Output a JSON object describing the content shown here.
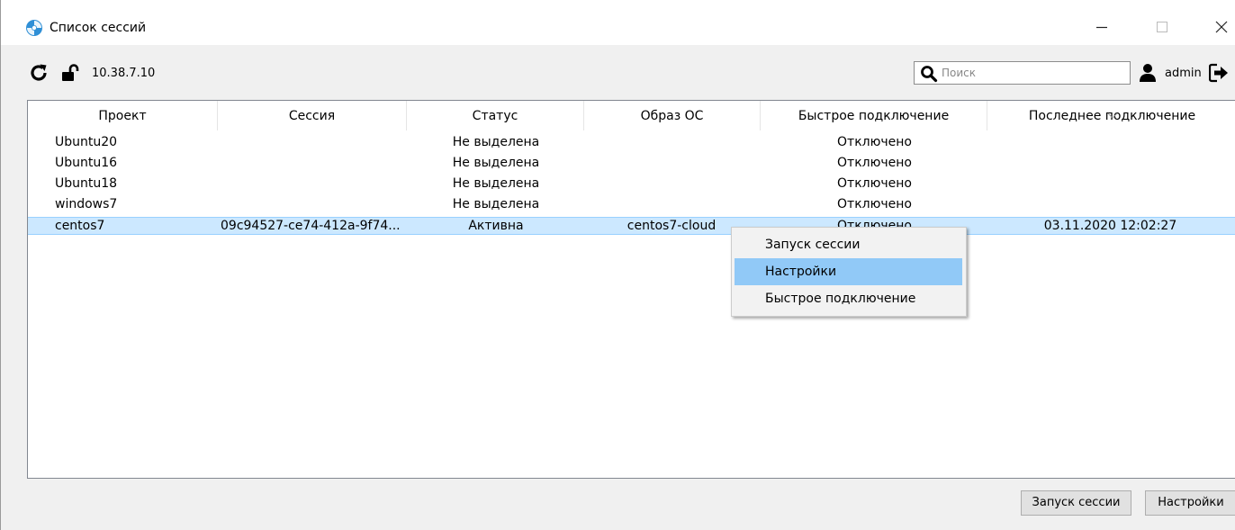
{
  "window": {
    "title": "Список сессий",
    "minimize_glyph": "—",
    "maximize_glyph": "☐",
    "close_glyph": "✕"
  },
  "toolbar": {
    "host": "10.38.7.10",
    "search_placeholder": "Поиск",
    "search_value": "",
    "user": "admin",
    "icons": [
      "refresh-icon",
      "unlock-icon",
      "search-icon",
      "user-icon",
      "logout-icon"
    ]
  },
  "table": {
    "columns": [
      "Проект",
      "Сессия",
      "Статус",
      "Образ ОС",
      "Быстрое подключение",
      "Последнее подключение"
    ],
    "sorted_column": "Последнее подключение",
    "rows": [
      {
        "project": "Ubuntu20",
        "session": "",
        "status": "Не выделена",
        "image": "",
        "quick": "Отключено",
        "last": ""
      },
      {
        "project": "Ubuntu16",
        "session": "",
        "status": "Не выделена",
        "image": "",
        "quick": "Отключено",
        "last": ""
      },
      {
        "project": "Ubuntu18",
        "session": "",
        "status": "Не выделена",
        "image": "",
        "quick": "Отключено",
        "last": ""
      },
      {
        "project": "windows7",
        "session": "",
        "status": "Не выделена",
        "image": "",
        "quick": "Отключено",
        "last": ""
      },
      {
        "project": "centos7",
        "session": "09c94527-ce74-412a-9f74...",
        "status": "Активна",
        "image": "centos7-cloud",
        "quick": "Отключено",
        "last": "03.11.2020 12:02:27"
      }
    ],
    "selected_row": 4
  },
  "context_menu": {
    "items": [
      "Запуск сессии",
      "Настройки",
      "Быстрое подключение"
    ],
    "highlighted_item": 1
  },
  "buttons": {
    "start_session": "Запуск сессии",
    "settings": "Настройки"
  },
  "colors": {
    "selection": "#cce8ff",
    "menu_highlight": "#91c9f7",
    "app_icon": "#2f8fd6"
  }
}
